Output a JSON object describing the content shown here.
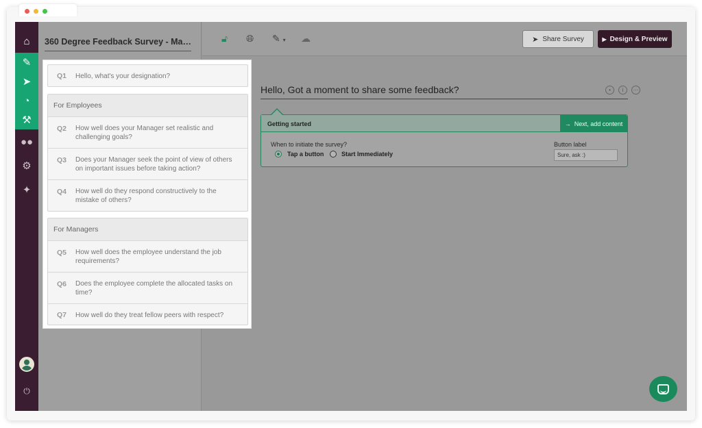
{
  "app": {
    "survey_title": "360 Degree Feedback Survey - Man...",
    "share_label": "Share Survey",
    "design_label": "Design & Preview"
  },
  "sidebar": {
    "icons": [
      "home-icon",
      "pencil-icon",
      "send-icon",
      "chart-icon",
      "wrench-icon",
      "users-icon",
      "gear-icon",
      "wand-icon"
    ],
    "accent": "#17a673",
    "background": "#3a1d30"
  },
  "questions": {
    "q1": {
      "num": "Q1",
      "text": "Hello, what's your designation?"
    },
    "employees": {
      "heading": "For Employees",
      "items": [
        {
          "num": "Q2",
          "text": "How well does your Manager set realistic and challenging goals?"
        },
        {
          "num": "Q3",
          "text": "Does your Manager seek the point of view of others on important issues before taking action?"
        },
        {
          "num": "Q4",
          "text": "How well do they respond constructively to the mistake of others?"
        }
      ]
    },
    "managers": {
      "heading": "For Managers",
      "items": [
        {
          "num": "Q5",
          "text": "How well does the employee understand the job requirements?"
        },
        {
          "num": "Q6",
          "text": "Does the employee complete the allocated tasks on time?"
        },
        {
          "num": "Q7",
          "text": "How well do they treat fellow peers with respect?"
        }
      ]
    }
  },
  "welcome": {
    "title": "Hello, Got a moment to share some feedback?"
  },
  "getting_started": {
    "title": "Getting started",
    "next_label": "Next, add content",
    "when_label": "When to initiate the survey?",
    "option_tap": "Tap a button",
    "option_immediate": "Start Immediately",
    "selected": "Tap a button",
    "button_label_caption": "Button label",
    "button_label_value": "Sure, ask :)"
  }
}
